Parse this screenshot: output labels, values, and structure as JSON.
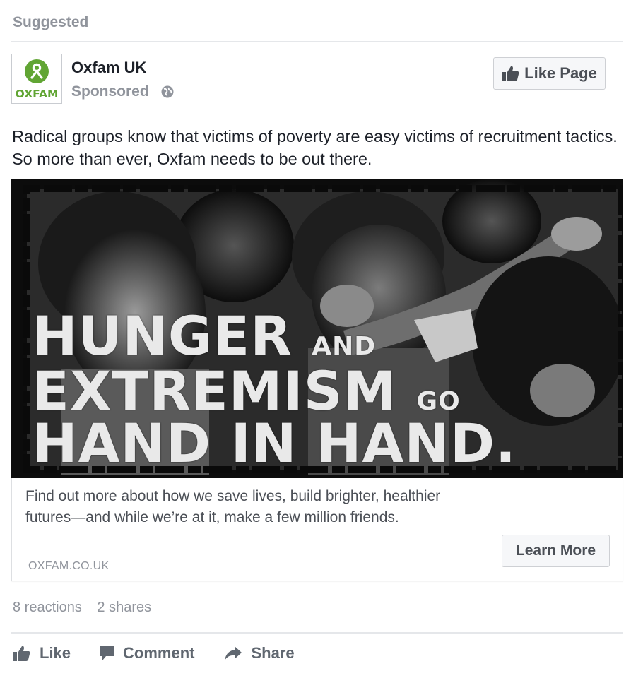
{
  "header": {
    "suggested_label": "Suggested"
  },
  "post": {
    "logo_text": "OXFAM",
    "page_name": "Oxfam UK",
    "sponsored_label": "Sponsored",
    "like_page_label": "Like Page",
    "text": "Radical groups know that victims of poverty are easy victims of recruitment tactics. So more than ever, Oxfam needs to be out there."
  },
  "ad_image": {
    "headline_line1_big": "HUNGER",
    "headline_line1_small": "AND",
    "headline_line2_big": "EXTREMISM",
    "headline_line2_small": "GO",
    "headline_line3": "HAND IN HAND."
  },
  "link_card": {
    "description": "Find out more about how we save lives, build brighter, healthier futures—and while we’re at it, make a few million friends.",
    "domain": "OXFAM.CO.UK",
    "cta_label": "Learn More"
  },
  "engagement": {
    "reactions": "8 reactions",
    "shares": "2 shares"
  },
  "actions": {
    "like": "Like",
    "comment": "Comment",
    "share": "Share"
  },
  "colors": {
    "oxfam_green": "#61a534",
    "muted_text": "#90949c",
    "button_bg": "#f6f7f9"
  }
}
